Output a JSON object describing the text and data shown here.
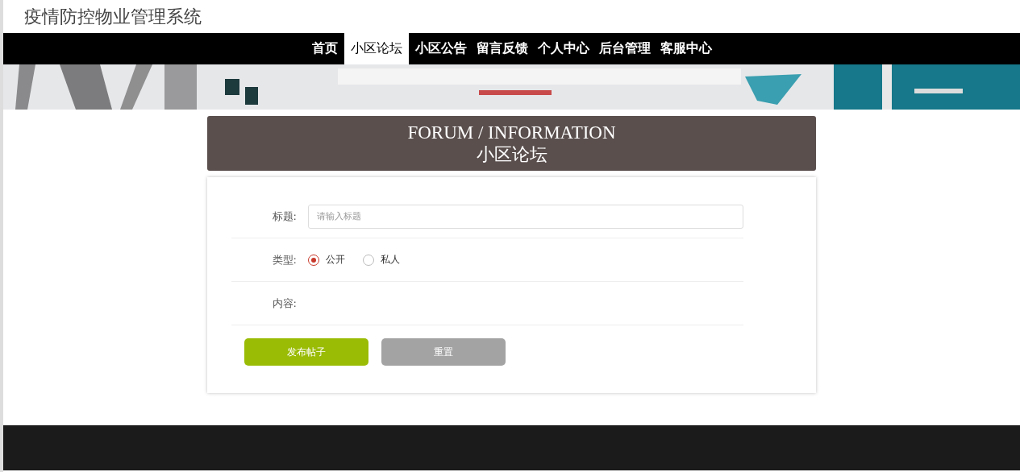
{
  "header": {
    "title": "疫情防控物业管理系统"
  },
  "nav": [
    {
      "label": "首页",
      "selected": false
    },
    {
      "label": "小区论坛",
      "selected": true
    },
    {
      "label": "小区公告",
      "selected": false
    },
    {
      "label": "留言反馈",
      "selected": false
    },
    {
      "label": "个人中心",
      "selected": false
    },
    {
      "label": "后台管理",
      "selected": false
    },
    {
      "label": "客服中心",
      "selected": false
    }
  ],
  "section": {
    "title_en": "FORUM / INFORMATION",
    "title_cn": "小区论坛"
  },
  "form": {
    "title_label": "标题:",
    "title_placeholder": "请输入标题",
    "type_label": "类型:",
    "type_options": [
      {
        "label": "公开",
        "selected": true
      },
      {
        "label": "私人",
        "selected": false
      }
    ],
    "content_label": "内容:",
    "buttons": [
      {
        "label": "发布帖子",
        "kind": "primary"
      },
      {
        "label": "重置",
        "kind": "secondary"
      }
    ]
  }
}
